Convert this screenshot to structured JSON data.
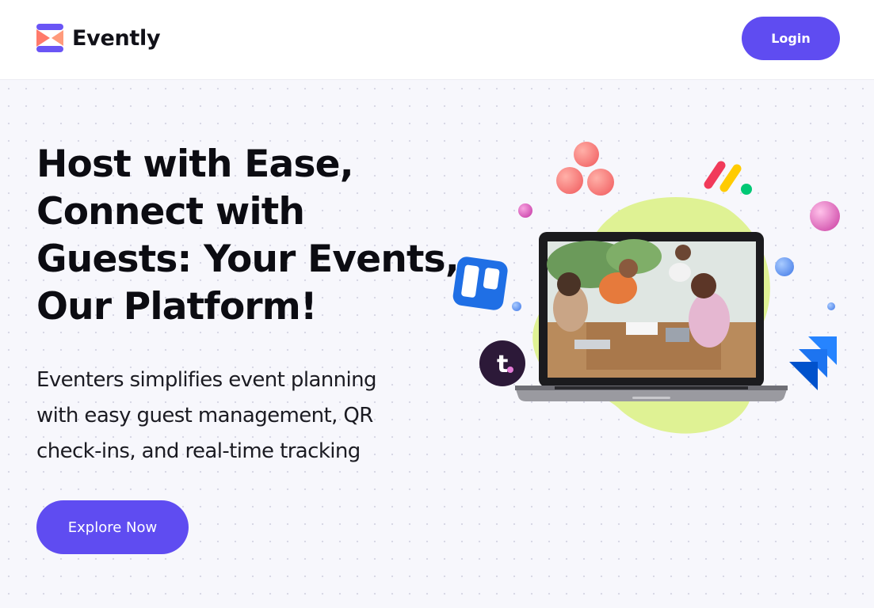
{
  "brand": {
    "name": "Evently",
    "logo_icon": "evently-logo-icon",
    "colors": {
      "primary": "#5f4cf1",
      "accent": "#ff7a6b"
    }
  },
  "nav": {
    "login_label": "Login"
  },
  "hero": {
    "title": "Host with Ease, Connect with Guests: Your Events, Our Platform!",
    "subtitle": "Eventers simplifies event planning with easy guest management, QR check-ins, and real-time tracking",
    "cta_label": "Explore Now"
  },
  "illustration": {
    "icons": [
      "asana-icon",
      "monday-icon",
      "trello-icon",
      "toggl-icon",
      "jira-icon"
    ],
    "photo": "laptop-team-photo"
  }
}
